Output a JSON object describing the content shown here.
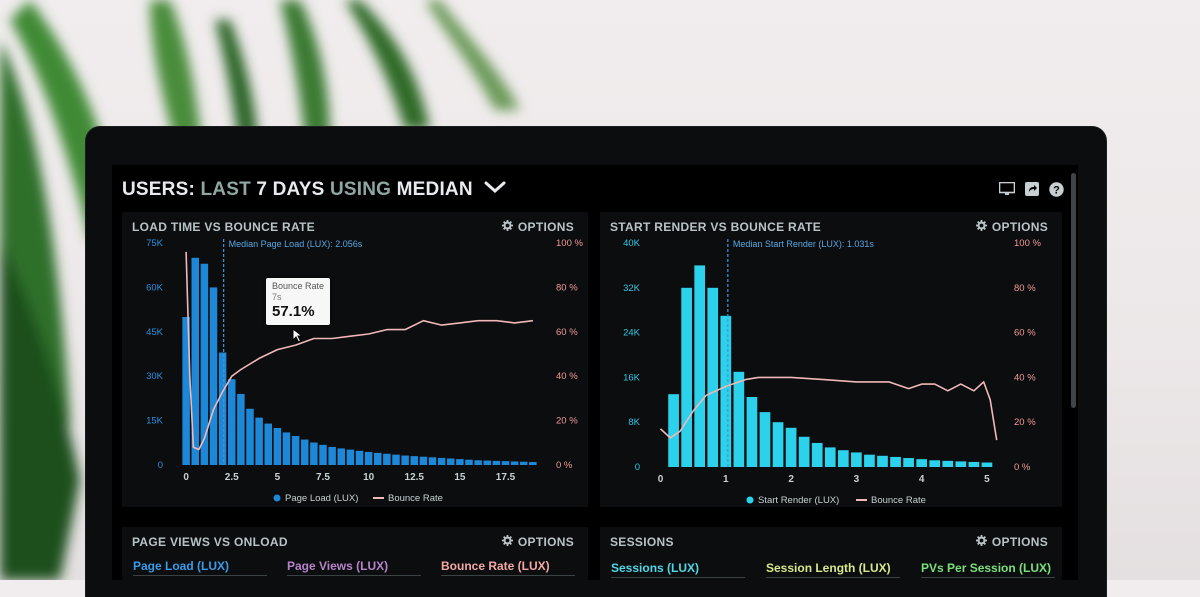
{
  "header": {
    "users_label": "USERS:",
    "last_label": "LAST",
    "days_label": "7 DAYS",
    "using_label": "USING",
    "median_label": "MEDIAN"
  },
  "icons": {
    "monitor": "monitor-icon",
    "share": "share-icon",
    "help": "help-icon",
    "gear": "gear-icon",
    "chevron": "chevron-down-icon"
  },
  "colors": {
    "bar_blue": "#1e88d8",
    "bar_cyan": "#2cd1ec",
    "bounce_line": "#f0b8b8",
    "median_line": "#3f96d8",
    "axis_left_blue": "#2f8fe0",
    "axis_left_cyan": "#30c8e8",
    "axis_right": "#f29a9a"
  },
  "panels": {
    "load_time": {
      "title": "LOAD TIME VS BOUNCE RATE",
      "options": "OPTIONS",
      "median_label": "Median Page Load (LUX): 2.056s",
      "legend_bar": "Page Load (LUX)",
      "legend_line": "Bounce Rate",
      "tooltip": {
        "series": "Bounce Rate",
        "x": "7s",
        "value": "57.1%"
      }
    },
    "start_render": {
      "title": "START RENDER VS BOUNCE RATE",
      "options": "OPTIONS",
      "median_label": "Median Start Render (LUX): 1.031s",
      "legend_bar": "Start Render (LUX)",
      "legend_line": "Bounce Rate"
    },
    "page_views": {
      "title": "PAGE VIEWS VS ONLOAD",
      "options": "OPTIONS",
      "tabs": [
        "Page Load (LUX)",
        "Page Views (LUX)",
        "Bounce Rate (LUX)"
      ]
    },
    "sessions": {
      "title": "SESSIONS",
      "options": "OPTIONS",
      "tabs": [
        "Sessions (LUX)",
        "Session Length (LUX)",
        "PVs Per Session (LUX)"
      ]
    }
  },
  "chart_data": [
    {
      "type": "bar",
      "title": "LOAD TIME VS BOUNCE RATE",
      "x_ticks": [
        "0",
        "2.5",
        "5",
        "7.5",
        "10",
        "12.5",
        "15",
        "17.5"
      ],
      "y_left_ticks": [
        "0",
        "15K",
        "30K",
        "45K",
        "60K",
        "75K"
      ],
      "y_right_ticks": [
        "0 %",
        "20 %",
        "40 %",
        "60 %",
        "80 %",
        "100 %"
      ],
      "xlim": [
        -0.5,
        19.5
      ],
      "ylim_left": [
        0,
        75000
      ],
      "ylim_right": [
        0,
        100
      ],
      "median_x": 2.056,
      "series": [
        {
          "name": "Page Load (LUX)",
          "x": [
            0,
            0.5,
            1,
            1.5,
            2,
            2.5,
            3,
            3.5,
            4,
            4.5,
            5,
            5.5,
            6,
            6.5,
            7,
            7.5,
            8,
            8.5,
            9,
            9.5,
            10,
            10.5,
            11,
            11.5,
            12,
            12.5,
            13,
            13.5,
            14,
            14.5,
            15,
            15.5,
            16,
            16.5,
            17,
            17.5,
            18,
            18.5,
            19
          ],
          "values": [
            50000,
            70000,
            68000,
            60000,
            38000,
            29000,
            24000,
            19000,
            16000,
            14000,
            12500,
            11000,
            9800,
            8600,
            7600,
            6800,
            6100,
            5600,
            5200,
            4800,
            4400,
            4100,
            3800,
            3500,
            3200,
            3000,
            2800,
            2600,
            2400,
            2200,
            2000,
            1800,
            1600,
            1500,
            1400,
            1300,
            1200,
            1100,
            1000
          ]
        },
        {
          "name": "Bounce Rate",
          "x": [
            0,
            0.2,
            0.4,
            0.7,
            1,
            1.5,
            2,
            2.5,
            3,
            4,
            5,
            6,
            7,
            8,
            9,
            10,
            11,
            12,
            13,
            14,
            15,
            16,
            17,
            18,
            19
          ],
          "values": [
            96,
            40,
            8,
            7,
            12,
            25,
            33,
            40,
            43,
            48,
            52,
            54,
            57,
            57,
            58,
            59,
            61,
            61,
            65,
            63,
            64,
            65,
            65,
            64,
            65
          ]
        }
      ]
    },
    {
      "type": "bar",
      "title": "START RENDER VS BOUNCE RATE",
      "x_ticks": [
        "0",
        "1",
        "2",
        "3",
        "4",
        "5"
      ],
      "y_left_ticks": [
        "0",
        "8K",
        "16K",
        "24K",
        "32K",
        "40K"
      ],
      "y_right_ticks": [
        "0 %",
        "20 %",
        "40 %",
        "60 %",
        "80 %",
        "100 %"
      ],
      "xlim": [
        -0.1,
        5.2
      ],
      "ylim_left": [
        0,
        40000
      ],
      "ylim_right": [
        0,
        100
      ],
      "median_x": 1.031,
      "series": [
        {
          "name": "Start Render (LUX)",
          "x": [
            0.2,
            0.4,
            0.6,
            0.8,
            1.0,
            1.2,
            1.4,
            1.6,
            1.8,
            2.0,
            2.2,
            2.4,
            2.6,
            2.8,
            3.0,
            3.2,
            3.4,
            3.6,
            3.8,
            4.0,
            4.2,
            4.4,
            4.6,
            4.8,
            5.0
          ],
          "values": [
            13000,
            32000,
            36000,
            32000,
            27000,
            17000,
            12500,
            9800,
            8000,
            7000,
            5400,
            4300,
            3500,
            3000,
            2600,
            2200,
            2000,
            1800,
            1600,
            1400,
            1200,
            1100,
            1000,
            900,
            800
          ]
        },
        {
          "name": "Bounce Rate",
          "x": [
            0,
            0.15,
            0.3,
            0.5,
            0.7,
            1.0,
            1.3,
            1.5,
            2.0,
            2.5,
            3.0,
            3.5,
            3.8,
            4.0,
            4.2,
            4.4,
            4.6,
            4.8,
            4.95,
            5.05,
            5.15
          ],
          "values": [
            17,
            13,
            16,
            25,
            32,
            36,
            39,
            40,
            40,
            39,
            38,
            38,
            35,
            37,
            37,
            34,
            37,
            34,
            38,
            30,
            12
          ]
        }
      ]
    }
  ]
}
